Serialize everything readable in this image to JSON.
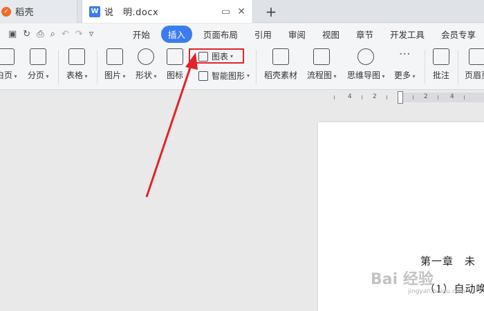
{
  "titlebar": {
    "inactive_tab": "稻壳",
    "active_tab_icon": "W",
    "active_tab": "说　明.docx",
    "new_tab": "+"
  },
  "menubar": {
    "items": [
      "开始",
      "插入",
      "页面布局",
      "引用",
      "审阅",
      "视图",
      "章节",
      "开发工具",
      "会员专享"
    ],
    "active_index": 1
  },
  "ribbon": {
    "blank_page": "白页",
    "page_break": "分页",
    "table": "表格",
    "picture": "图片",
    "shape": "形状",
    "icon": "图标",
    "chart": "图表",
    "smart_art": "智能图形",
    "docer_assets": "稻壳素材",
    "flowchart": "流程图",
    "mindmap": "思维导图",
    "more": "更多",
    "comment": "批注",
    "header_footer": "页眉页"
  },
  "ruler": {
    "marks": [
      "4",
      "2",
      "2",
      "4"
    ]
  },
  "document": {
    "line1": "第一章　未",
    "line2": "（1）自动唤"
  },
  "watermark": {
    "text": "Bai 经验",
    "sub": "jingyan.baidu.com"
  },
  "colors": {
    "accent": "#3b7cf0",
    "highlight": "#e0242a",
    "arrow": "#e0242a"
  }
}
